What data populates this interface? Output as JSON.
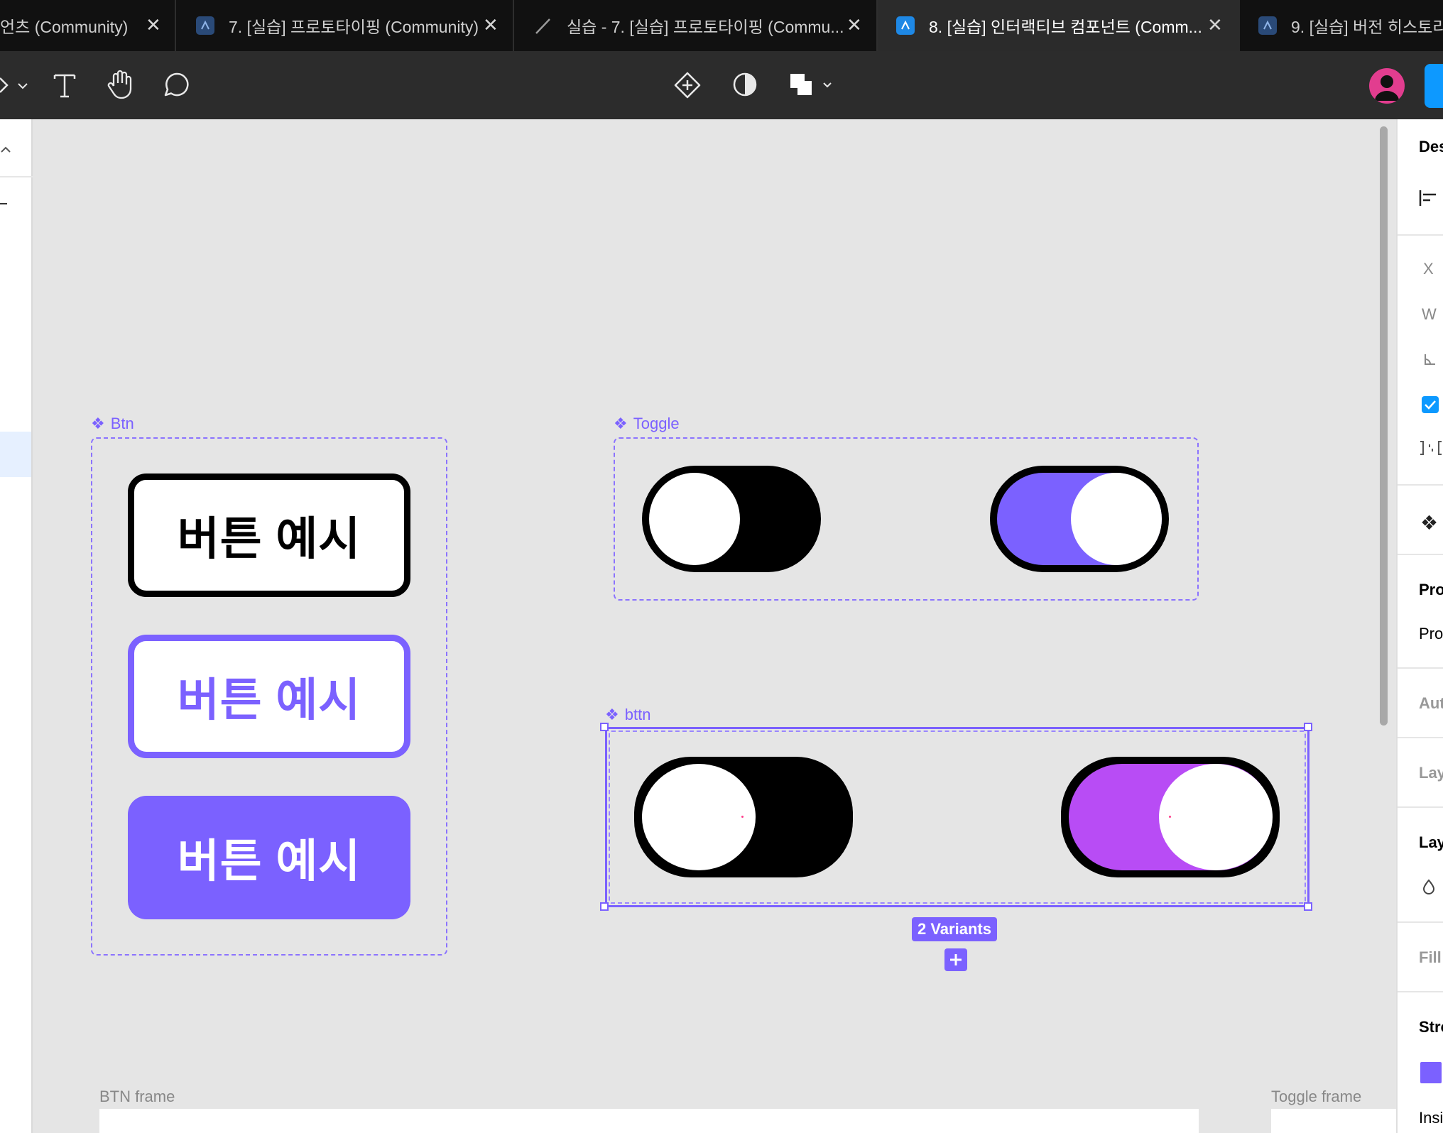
{
  "tabs": [
    {
      "title": "언츠 (Community)",
      "active": false,
      "icon": "none"
    },
    {
      "title": "7. [실습] 프로토타이핑 (Community)",
      "active": false,
      "icon": "figma-file-icon"
    },
    {
      "title": "실습 - 7. [실습] 프로토타이핑 (Commu...",
      "active": false,
      "icon": "pen-icon"
    },
    {
      "title": "8. [실습] 인터랙티브 컴포넌트 (Comm...",
      "active": true,
      "icon": "figma-file-icon"
    },
    {
      "title": "9. [실습] 버전 히스토리 (",
      "active": false,
      "icon": "figma-file-icon"
    }
  ],
  "toolbar": {
    "left_tools": [
      "pen-tool-icon",
      "text-tool-icon",
      "hand-tool-icon",
      "comment-tool-icon"
    ],
    "center_tools": [
      "component-icon",
      "contrast-icon",
      "boolean-ops-icon"
    ]
  },
  "right_panel": {
    "design_tab": "Des",
    "x_label": "X",
    "w_label": "W",
    "properties_heading": "Pro",
    "properties_item": "Pro",
    "auto_layout": "Aut",
    "layout": "Lay",
    "layer": "Lay",
    "fill": "Fill",
    "stroke": "Stro",
    "inside": "Insi"
  },
  "canvas": {
    "btn_component": {
      "label": "Btn",
      "buttons": [
        {
          "text": "버튼 예시",
          "style": "outline-black"
        },
        {
          "text": "버튼 예시",
          "style": "outline-purple"
        },
        {
          "text": "버튼 예시",
          "style": "filled-purple"
        }
      ]
    },
    "toggle_component": {
      "label": "Toggle",
      "states": [
        "off",
        "on"
      ]
    },
    "bttn_component": {
      "label": "bttn",
      "states": [
        "off",
        "on"
      ],
      "variants_badge": "2 Variants"
    },
    "frames": [
      "BTN frame",
      "Toggle frame"
    ]
  },
  "colors": {
    "accent": "#7b61ff",
    "toggle_on_purple": "#7b61ff",
    "toggle_on_magenta": "#b84cf5",
    "tabbar_bg": "#111111",
    "toolbar_bg": "#2c2c2c",
    "canvas_bg": "#e5e5e5",
    "figma_blue": "#0d99ff"
  }
}
